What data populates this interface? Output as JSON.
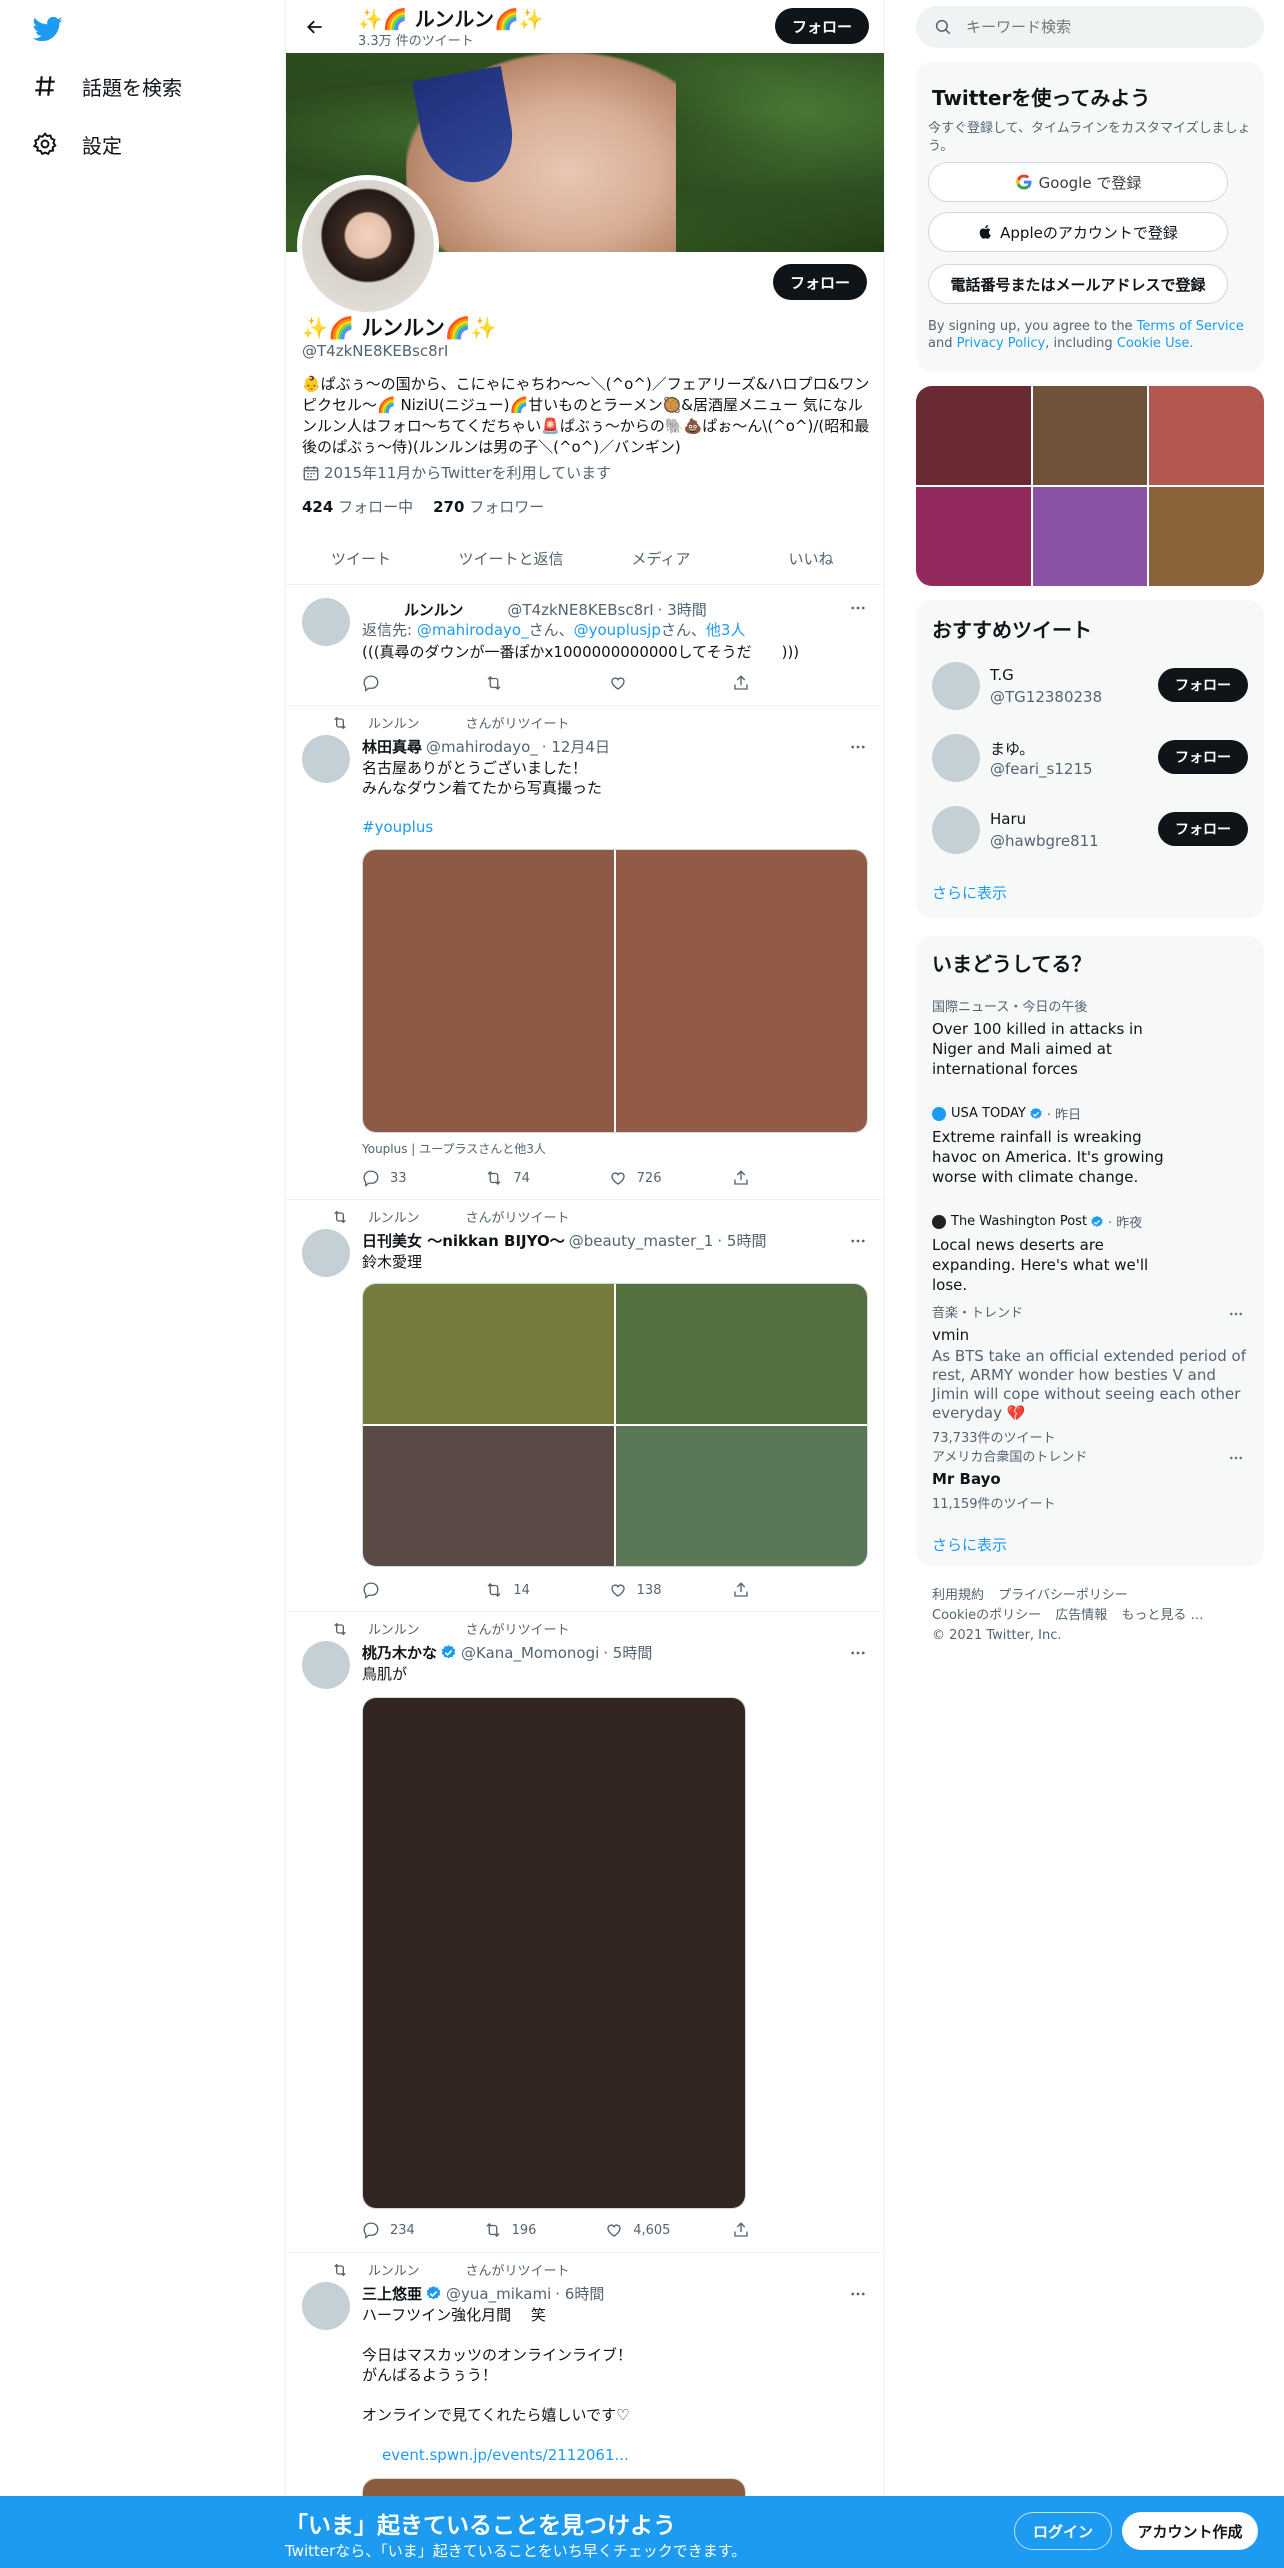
{
  "nav": {
    "explore_label": "話題を検索",
    "settings_label": "設定"
  },
  "topbar": {
    "title": "✨🌈 ルンルン🌈✨",
    "tweet_count": "3.3万 件のツイート",
    "follow_label": "フォロー"
  },
  "profile": {
    "name": "✨🌈 ルンルン🌈✨",
    "handle": "@T4zkNE8KEBsc8rI",
    "bio": "👶ぱぶぅ〜の国から、こにゃにゃちわ〜〜＼(^o^)／フェアリーズ&ハロプロ&ワンピクセル〜🌈 NiziU(ニジュー)🌈甘いものとラーメン🥘&居酒屋メニュー 気になルンルン人はフォロ〜ちてくだちゃい🚨ぱぶぅ〜からの🐘💩ぱぉ〜ん\\(^o^)/(昭和最後のぱぶぅ〜侍)(ルンルンは男の子＼(^o^)／バンギン)",
    "joined": "2015年11月からTwitterを利用しています",
    "following_count": "424",
    "following_label": "フォロー中",
    "followers_count": "270",
    "followers_label": "フォロワー",
    "follow_label": "フォロー"
  },
  "tabs": [
    "ツイート",
    "ツイートと返信",
    "メディア",
    "いいね"
  ],
  "tweets": [
    {
      "name": "ルンルン",
      "handle": "@T4zkNE8KEBsc8rI",
      "time": "· 3時間",
      "reply_prefix": "返信先: ",
      "reply_to_1": "@mahirodayo_",
      "reply_mid": "さん、",
      "reply_to_2": "@youplusjp",
      "reply_mid2": "さん、",
      "reply_others": "他3人",
      "text": "(((真尋のダウンが一番ぽかx1000000000000してそうだ　　)))"
    },
    {
      "retweeter": "ルンルン",
      "retweet_suffix": "さんがリツイート",
      "name": "林田真尋",
      "handle": "@mahirodayo_",
      "time": "· 12月4日",
      "text": "名古屋ありがとうございました！\nみんなダウン着てたから写真撮った",
      "hashtag": "#youplus",
      "media_caption": "Youplus | ユープラスさんと他3人",
      "media_colors": [
        "#8f5a45",
        "#935b46"
      ],
      "replies": "33",
      "retweets": "74",
      "likes": "726"
    },
    {
      "retweeter": "ルンルン",
      "retweet_suffix": "さんがリツイート",
      "name": "日刊美女 〜nikkan BIJYO〜",
      "handle": "@beauty_master_1",
      "time": "· 5時間",
      "text": "鈴木愛理",
      "media_colors": [
        "#757b3d",
        "#55703f",
        "#5a4a46",
        "#5a7858"
      ],
      "replies": "",
      "retweets": "14",
      "likes": "138"
    },
    {
      "retweeter": "ルンルン",
      "retweet_suffix": "さんがリツイート",
      "name": "桃乃木かな",
      "handle": "@Kana_Momonogi",
      "time": "· 5時間",
      "text": "鳥肌が",
      "media_colors": [
        "#332622"
      ],
      "replies": "234",
      "retweets": "196",
      "likes": "4,605"
    },
    {
      "retweeter": "ルンルン",
      "retweet_suffix": "さんがリツイート",
      "name": "三上悠亜",
      "handle": "@yua_mikami",
      "time": "· 6時間",
      "text": "ハーフツイン強化月間　 笑\n\n今日はマスカッツのオンラインライブ！\nがんばるようぅう！\n\nオンラインで見てくれたら嬉しいです♡",
      "link": "event.spwn.jp/events/2112061...",
      "media_colors": [
        "#8a5e3c"
      ]
    }
  ],
  "search": {
    "placeholder": "キーワード検索"
  },
  "signup": {
    "title": "Twitterを使ってみよう",
    "desc": "今すぐ登録して、タイムラインをカスタマイズしましょう。",
    "google_label": "Google で登録",
    "apple_label": "Appleのアカウントで登録",
    "phone_label": "電話番号またはメールアドレスで登録",
    "legal_prefix": "By signing up, you agree to the ",
    "terms": "Terms of Service",
    "legal_and": " and ",
    "privacy": "Privacy Policy",
    "legal_including": ", including ",
    "cookie": "Cookie Use."
  },
  "profile_media_colors": [
    "#6a2a34",
    "#6e5239",
    "#b4574e",
    "#922a5d",
    "#8952a4",
    "#8a6339"
  ],
  "recommended": {
    "title": "おすすめツイート",
    "follow_label": "フォロー",
    "show_more": "さらに表示",
    "users": [
      {
        "name": "T.G",
        "handle": "@TG12380238"
      },
      {
        "name": "まゆ。",
        "handle": "@feari_s1215"
      },
      {
        "name": "Haru",
        "handle": "@hawbgre811"
      }
    ]
  },
  "trends": {
    "title": "いまどうしてる？",
    "show_more": "さらに表示",
    "items": [
      {
        "meta": "国際ニュース・今日の午後",
        "title": "Over 100 killed in attacks in Niger and Mali aimed at international forces"
      },
      {
        "source": "USA TODAY",
        "meta": "· 昨日",
        "title": "Extreme rainfall is wreaking havoc on America. It's growing worse with climate change."
      },
      {
        "source": "The Washington Post",
        "meta": "· 昨夜",
        "title": "Local news deserts are expanding. Here's what we'll lose."
      },
      {
        "meta": "音楽・トレンド",
        "title": "vmin",
        "desc": "As BTS take an official extended period of rest, ARMY wonder how besties V and Jimin will cope without seeing each other everyday 💔",
        "count": "73,733件のツイート"
      },
      {
        "meta": "アメリカ合衆国のトレンド",
        "title": "Mr Bayo",
        "count": "11,159件のツイート"
      }
    ]
  },
  "footer": {
    "terms": "利用規約",
    "privacy": "プライバシーポリシー",
    "cookie": "Cookieのポリシー",
    "ads": "広告情報",
    "more": "もっと見る …",
    "copyright": "© 2021 Twitter, Inc."
  },
  "bottombar": {
    "title": "「いま」起きていることを見つけよう",
    "subtitle": "Twitterなら、「いま」起きていることをいち早くチェックできます。",
    "login_label": "ログイン",
    "signup_label": "アカウント作成"
  },
  "colors": {
    "accent": "#1d9bf0",
    "text": "#0f1419",
    "secondary": "#536471"
  }
}
